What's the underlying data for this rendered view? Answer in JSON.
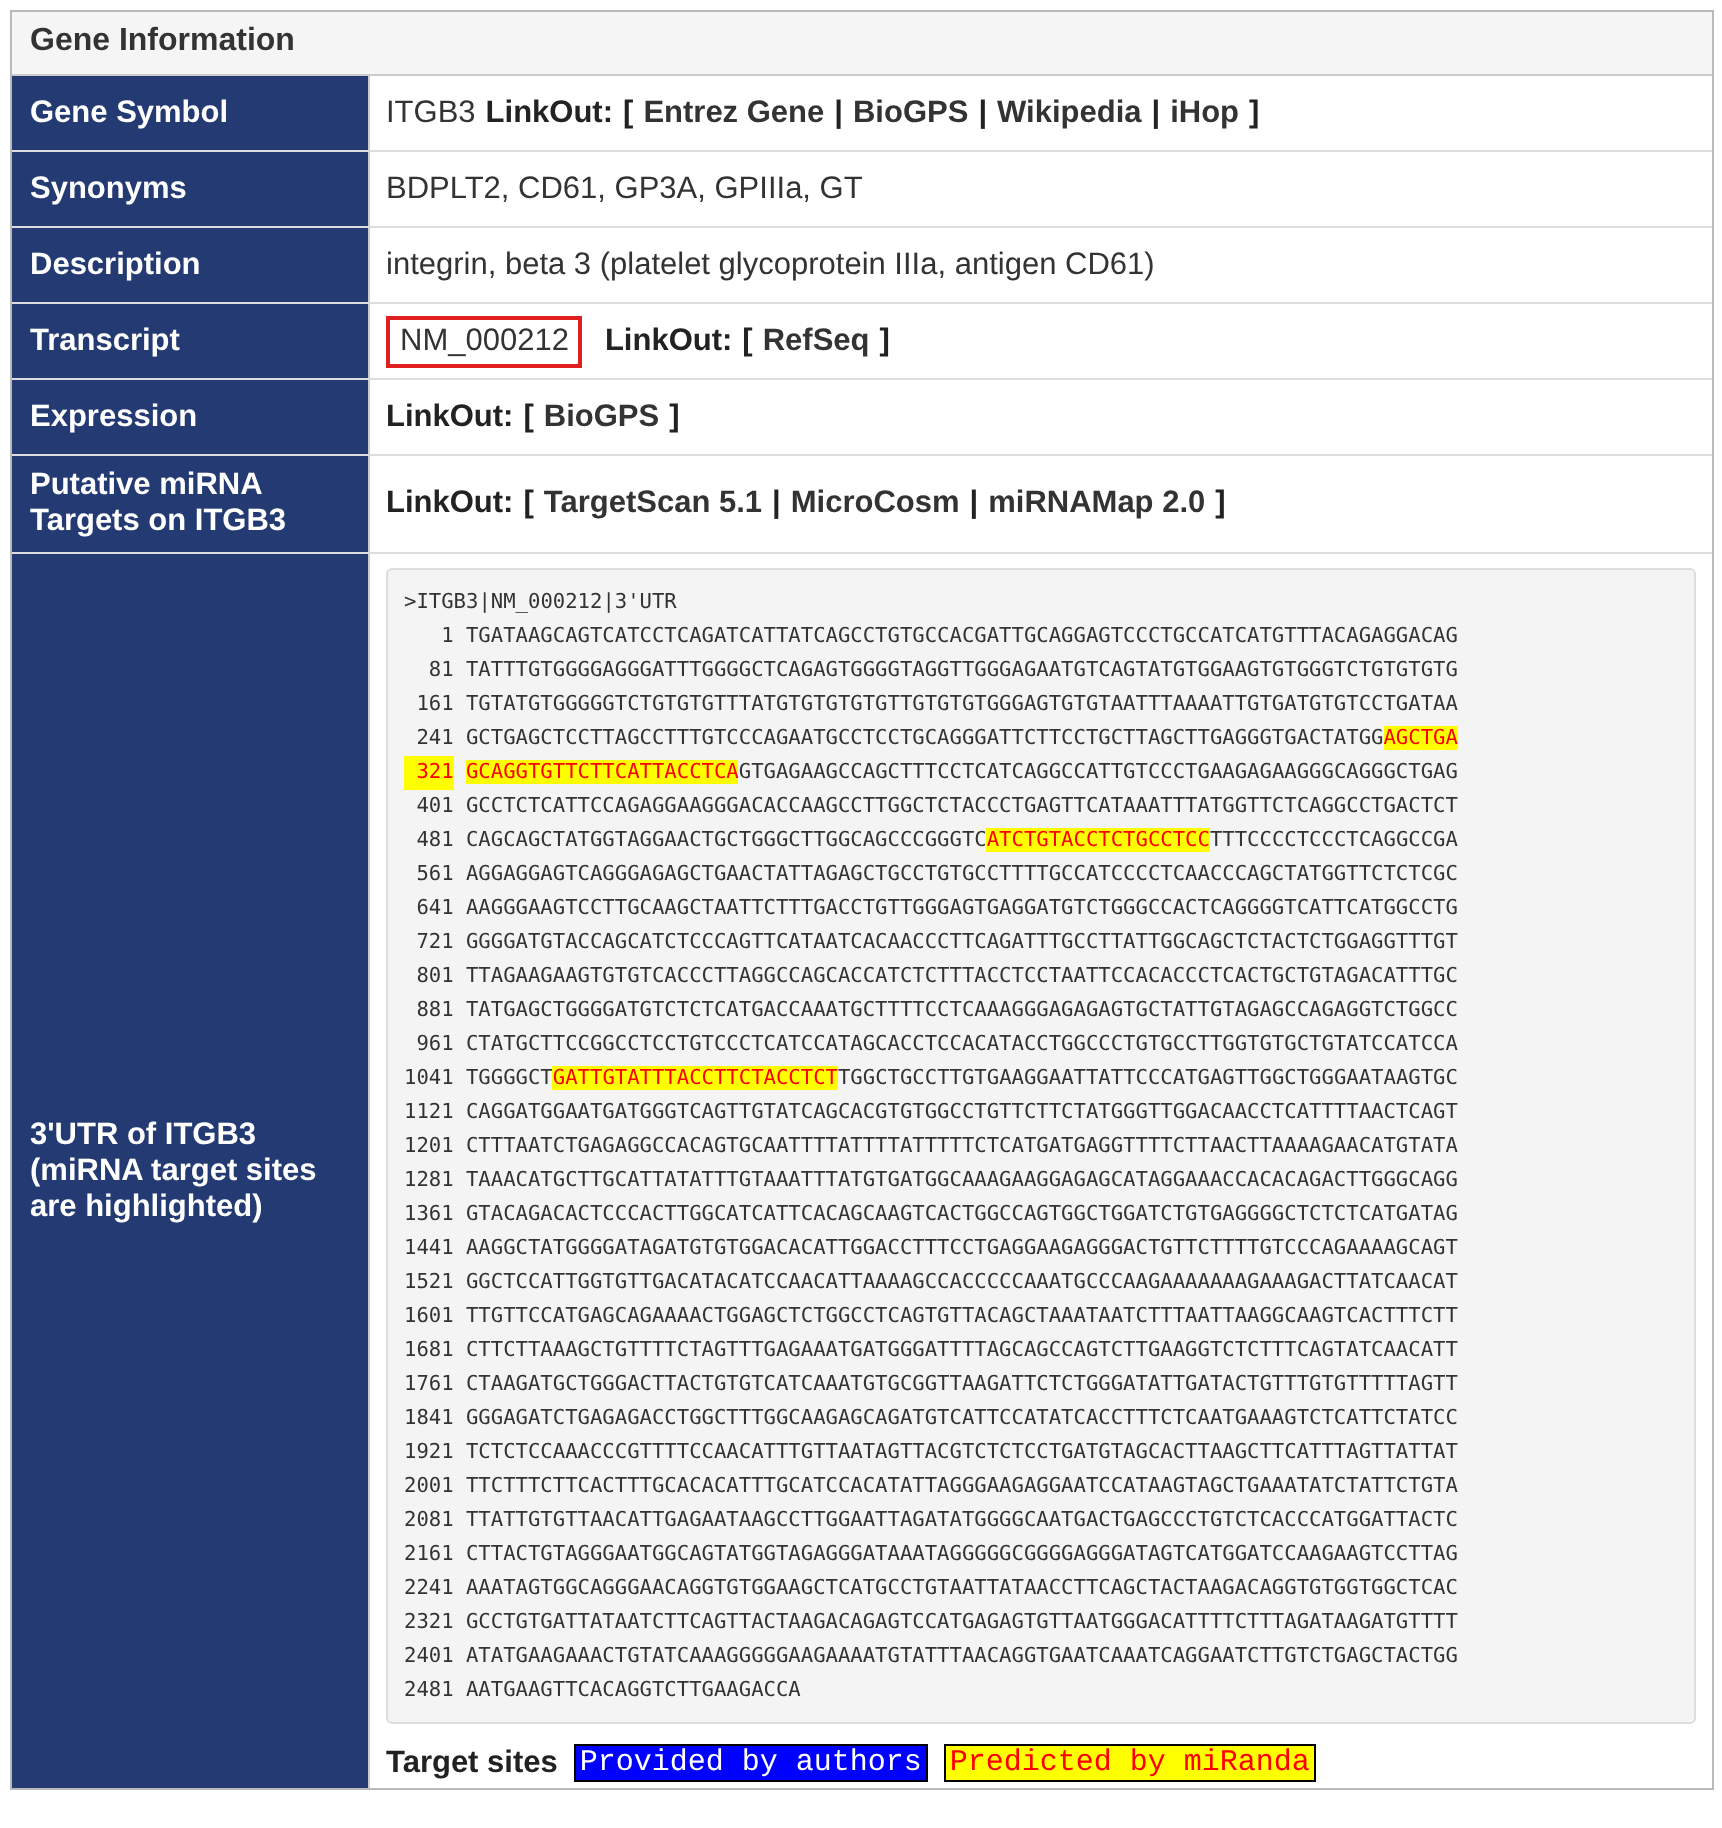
{
  "panel": {
    "title": "Gene Information"
  },
  "rows": [
    {
      "label": "Gene Symbol",
      "parts": [
        {
          "kind": "text",
          "text": "ITGB3"
        },
        {
          "kind": "bold",
          "text": "LinkOut:"
        },
        {
          "kind": "bold",
          "text": "["
        },
        {
          "kind": "link",
          "text": "Entrez Gene"
        },
        {
          "kind": "bold",
          "text": "|"
        },
        {
          "kind": "link",
          "text": "BioGPS"
        },
        {
          "kind": "bold",
          "text": "|"
        },
        {
          "kind": "link",
          "text": "Wikipedia"
        },
        {
          "kind": "bold",
          "text": "|"
        },
        {
          "kind": "link",
          "text": "iHop"
        },
        {
          "kind": "bold",
          "text": "]"
        }
      ]
    },
    {
      "label": "Synonyms",
      "parts": [
        {
          "kind": "text",
          "text": "BDPLT2, CD61, GP3A, GPIIIa, GT"
        }
      ]
    },
    {
      "label": "Description",
      "parts": [
        {
          "kind": "text",
          "text": "integrin, beta 3 (platelet glycoprotein IIIa, antigen CD61)"
        }
      ]
    },
    {
      "label": "Transcript",
      "parts": [
        {
          "kind": "boxed",
          "text": "NM_000212"
        },
        {
          "kind": "bold",
          "text": "LinkOut:"
        },
        {
          "kind": "bold",
          "text": "["
        },
        {
          "kind": "link",
          "text": "RefSeq"
        },
        {
          "kind": "bold",
          "text": "]"
        }
      ]
    },
    {
      "label": "Expression",
      "parts": [
        {
          "kind": "bold",
          "text": "LinkOut:"
        },
        {
          "kind": "bold",
          "text": "["
        },
        {
          "kind": "link",
          "text": "BioGPS"
        },
        {
          "kind": "bold",
          "text": "]"
        }
      ]
    },
    {
      "label": "Putative miRNA Targets on ITGB3",
      "parts": [
        {
          "kind": "bold",
          "text": "LinkOut:"
        },
        {
          "kind": "bold",
          "text": "["
        },
        {
          "kind": "link",
          "text": "TargetScan 5.1"
        },
        {
          "kind": "bold",
          "text": "|"
        },
        {
          "kind": "link",
          "text": "MicroCosm"
        },
        {
          "kind": "bold",
          "text": "|"
        },
        {
          "kind": "link",
          "text": "miRNAMap 2.0"
        },
        {
          "kind": "bold",
          "text": "]"
        }
      ]
    }
  ],
  "utr": {
    "label": "3'UTR of ITGB3 (miRNA target sites are highlighted)",
    "header": ">ITGB3|NM_000212|3'UTR",
    "lines": [
      {
        "number": "1",
        "number_highlight": false,
        "segments": [
          {
            "kind": "plain",
            "text": "TGATAAGCAGTCATCCTCAGATCATTATCAGCCTGTGCCACGATTGCAGGAGTCCCTGCCATCATGTTTACAGAGGACAG"
          }
        ]
      },
      {
        "number": "81",
        "number_highlight": false,
        "segments": [
          {
            "kind": "plain",
            "text": "TATTTGTGGGGAGGGATTTGGGGCTCAGAGTGGGGTAGGTTGGGAGAATGTCAGTATGTGGAAGTGTGGGTCTGTGTGTG"
          }
        ]
      },
      {
        "number": "161",
        "number_highlight": false,
        "segments": [
          {
            "kind": "plain",
            "text": "TGTATGTGGGGGTCTGTGTGTTTATGTGTGTGTGTTGTGTGTGGGAGTGTGTAATTTAAAATTGTGATGTGTCCTGATAA"
          }
        ]
      },
      {
        "number": "241",
        "number_highlight": false,
        "segments": [
          {
            "kind": "plain",
            "text": "GCTGAGCTCCTTAGCCTTTGTCCCAGAATGCCTCCTGCAGGGATTCTTCCTGCTTAGCTTGAGGGTGACTATGG"
          },
          {
            "kind": "predicted",
            "text": "AGCTGA"
          }
        ]
      },
      {
        "number": "321",
        "number_highlight": true,
        "segments": [
          {
            "kind": "predicted",
            "text": "GCAGGTGTTCTTCATTACCTCA"
          },
          {
            "kind": "plain",
            "text": "GTGAGAAGCCAGCTTTCCTCATCAGGCCATTGTCCCTGAAGAGAAGGGCAGGGCTGAG"
          }
        ]
      },
      {
        "number": "401",
        "number_highlight": false,
        "segments": [
          {
            "kind": "plain",
            "text": "GCCTCTCATTCCAGAGGAAGGGACACCAAGCCTTGGCTCTACCCTGAGTTCATAAATTTATGGTTCTCAGGCCTGACTCT"
          }
        ]
      },
      {
        "number": "481",
        "number_highlight": false,
        "segments": [
          {
            "kind": "plain",
            "text": "CAGCAGCTATGGTAGGAACTGCTGGGCTTGGCAGCCCGGGTC"
          },
          {
            "kind": "predicted",
            "text": "ATCTGTACCTCTGCCTCC"
          },
          {
            "kind": "plain",
            "text": "TTTCCCCTCCCTCAGGCCGA"
          }
        ]
      },
      {
        "number": "561",
        "number_highlight": false,
        "segments": [
          {
            "kind": "plain",
            "text": "AGGAGGAGTCAGGGAGAGCTGAACTATTAGAGCTGCCTGTGCCTTTTGCCATCCCCTCAACCCAGCTATGGTTCTCTCGC"
          }
        ]
      },
      {
        "number": "641",
        "number_highlight": false,
        "segments": [
          {
            "kind": "plain",
            "text": "AAGGGAAGTCCTTGCAAGCTAATTCTTTGACCTGTTGGGAGTGAGGATGTCTGGGCCACTCAGGGGTCATTCATGGCCTG"
          }
        ]
      },
      {
        "number": "721",
        "number_highlight": false,
        "segments": [
          {
            "kind": "plain",
            "text": "GGGGATGTACCAGCATCTCCCAGTTCATAATCACAACCCTTCAGATTTGCCTTATTGGCAGCTCTACTCTGGAGGTTTGT"
          }
        ]
      },
      {
        "number": "801",
        "number_highlight": false,
        "segments": [
          {
            "kind": "plain",
            "text": "TTAGAAGAAGTGTGTCACCCTTAGGCCAGCACCATCTCTTTACCTCCTAATTCCACACCCTCACTGCTGTAGACATTTGC"
          }
        ]
      },
      {
        "number": "881",
        "number_highlight": false,
        "segments": [
          {
            "kind": "plain",
            "text": "TATGAGCTGGGGATGTCTCTCATGACCAAATGCTTTTCCTCAAAGGGAGAGAGTGCTATTGTAGAGCCAGAGGTCTGGCC"
          }
        ]
      },
      {
        "number": "961",
        "number_highlight": false,
        "segments": [
          {
            "kind": "plain",
            "text": "CTATGCTTCCGGCCTCCTGTCCCTCATCCATAGCACCTCCACATACCTGGCCCTGTGCCTTGGTGTGCTGTATCCATCCA"
          }
        ]
      },
      {
        "number": "1041",
        "number_highlight": false,
        "segments": [
          {
            "kind": "plain",
            "text": "TGGGGCT"
          },
          {
            "kind": "predicted",
            "text": "GATTGTATTTACCTTCTACCTCT"
          },
          {
            "kind": "plain",
            "text": "TGGCTGCCTTGTGAAGGAATTATTCCCATGAGTTGGCTGGGAATAAGTGC"
          }
        ]
      },
      {
        "number": "1121",
        "number_highlight": false,
        "segments": [
          {
            "kind": "plain",
            "text": "CAGGATGGAATGATGGGTCAGTTGTATCAGCACGTGTGGCCTGTTCTTCTATGGGTTGGACAACCTCATTTTAACTCAGT"
          }
        ]
      },
      {
        "number": "1201",
        "number_highlight": false,
        "segments": [
          {
            "kind": "plain",
            "text": "CTTTAATCTGAGAGGCCACAGTGCAATTTTATTTTATTTTTCTCATGATGAGGTTTTCTTAACTTAAAAGAACATGTATA"
          }
        ]
      },
      {
        "number": "1281",
        "number_highlight": false,
        "segments": [
          {
            "kind": "plain",
            "text": "TAAACATGCTTGCATTATATTTGTAAATTTATGTGATGGCAAAGAAGGAGAGCATAGGAAACCACACAGACTTGGGCAGG"
          }
        ]
      },
      {
        "number": "1361",
        "number_highlight": false,
        "segments": [
          {
            "kind": "plain",
            "text": "GTACAGACACTCCCACTTGGCATCATTCACAGCAAGTCACTGGCCAGTGGCTGGATCTGTGAGGGGCTCTCTCATGATAG"
          }
        ]
      },
      {
        "number": "1441",
        "number_highlight": false,
        "segments": [
          {
            "kind": "plain",
            "text": "AAGGCTATGGGGATAGATGTGTGGACACATTGGACCTTTCCTGAGGAAGAGGGACTGTTCTTTTGTCCCAGAAAAGCAGT"
          }
        ]
      },
      {
        "number": "1521",
        "number_highlight": false,
        "segments": [
          {
            "kind": "plain",
            "text": "GGCTCCATTGGTGTTGACATACATCCAACATTAAAAGCCACCCCCAAATGCCCAAGAAAAAAAGAAAGACTTATCAACAT"
          }
        ]
      },
      {
        "number": "1601",
        "number_highlight": false,
        "segments": [
          {
            "kind": "plain",
            "text": "TTGTTCCATGAGCAGAAAACTGGAGCTCTGGCCTCAGTGTTACAGCTAAATAATCTTTAATTAAGGCAAGTCACTTTCTT"
          }
        ]
      },
      {
        "number": "1681",
        "number_highlight": false,
        "segments": [
          {
            "kind": "plain",
            "text": "CTTCTTAAAGCTGTTTTCTAGTTTGAGAAATGATGGGATTTTAGCAGCCAGTCTTGAAGGTCTCTTTCAGTATCAACATT"
          }
        ]
      },
      {
        "number": "1761",
        "number_highlight": false,
        "segments": [
          {
            "kind": "plain",
            "text": "CTAAGATGCTGGGACTTACTGTGTCATCAAATGTGCGGTTAAGATTCTCTGGGATATTGATACTGTTTGTGTTTTTAGTT"
          }
        ]
      },
      {
        "number": "1841",
        "number_highlight": false,
        "segments": [
          {
            "kind": "plain",
            "text": "GGGAGATCTGAGAGACCTGGCTTTGGCAAGAGCAGATGTCATTCCATATCACCTTTCTCAATGAAAGTCTCATTCTATCC"
          }
        ]
      },
      {
        "number": "1921",
        "number_highlight": false,
        "segments": [
          {
            "kind": "plain",
            "text": "TCTCTCCAAACCCGTTTTCCAACATTTGTTAATAGTTACGTCTCTCCTGATGTAGCACTTAAGCTTCATTTAGTTATTAT"
          }
        ]
      },
      {
        "number": "2001",
        "number_highlight": false,
        "segments": [
          {
            "kind": "plain",
            "text": "TTCTTTCTTCACTTTGCACACATTTGCATCCACATATTAGGGAAGAGGAATCCATAAGTAGCTGAAATATCTATTCTGTA"
          }
        ]
      },
      {
        "number": "2081",
        "number_highlight": false,
        "segments": [
          {
            "kind": "plain",
            "text": "TTATTGTGTTAACATTGAGAATAAGCCTTGGAATTAGATATGGGGCAATGACTGAGCCCTGTCTCACCCATGGATTACTC"
          }
        ]
      },
      {
        "number": "2161",
        "number_highlight": false,
        "segments": [
          {
            "kind": "plain",
            "text": "CTTACTGTAGGGAATGGCAGTATGGTAGAGGGATAAATAGGGGGCGGGGAGGGATAGTCATGGATCCAAGAAGTCCTTAG"
          }
        ]
      },
      {
        "number": "2241",
        "number_highlight": false,
        "segments": [
          {
            "kind": "plain",
            "text": "AAATAGTGGCAGGGAACAGGTGTGGAAGCTCATGCCTGTAATTATAACCTTCAGCTACTAAGACAGGTGTGGTGGCTCAC"
          }
        ]
      },
      {
        "number": "2321",
        "number_highlight": false,
        "segments": [
          {
            "kind": "plain",
            "text": "GCCTGTGATTATAATCTTCAGTTACTAAGACAGAGTCCATGAGAGTGTTAATGGGACATTTTCTTTAGATAAGATGTTTT"
          }
        ]
      },
      {
        "number": "2401",
        "number_highlight": false,
        "segments": [
          {
            "kind": "plain",
            "text": "ATATGAAGAAACTGTATCAAAGGGGGAAGAAAATGTATTTAACAGGTGAATCAAATCAGGAATCTTGTCTGAGCTACTGG"
          }
        ]
      },
      {
        "number": "2481",
        "number_highlight": false,
        "segments": [
          {
            "kind": "plain",
            "text": "AATGAAGTTCACAGGTCTTGAAGACCA"
          }
        ]
      }
    ],
    "legend": {
      "title": "Target sites",
      "items": [
        {
          "kind": "provided",
          "text": "Provided by authors"
        },
        {
          "kind": "predicted",
          "text": "Predicted by miRanda"
        }
      ]
    }
  }
}
